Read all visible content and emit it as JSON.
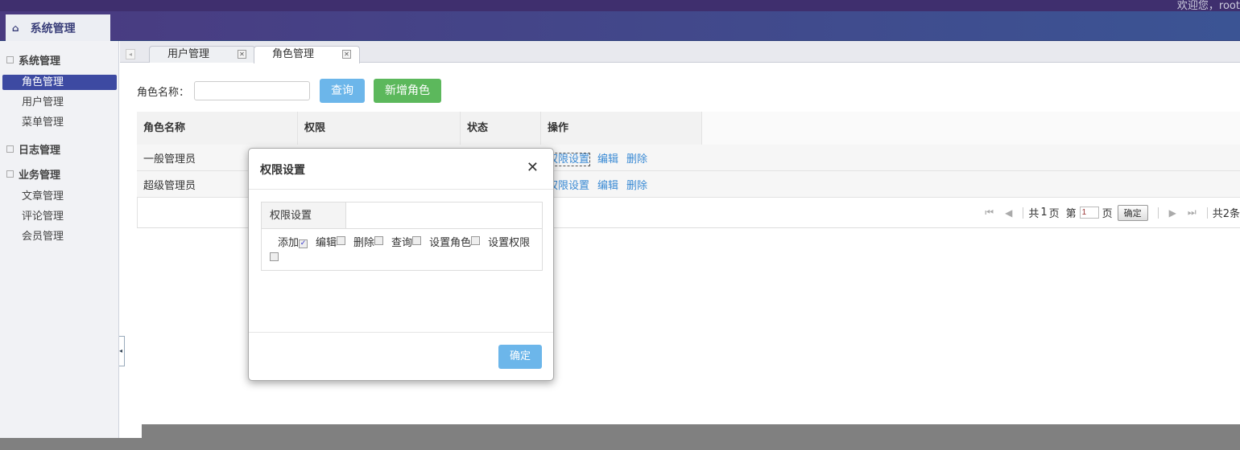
{
  "header": {
    "welcome": "欢迎您，root",
    "app_tab": "系统管理"
  },
  "sidebar": {
    "groups": [
      {
        "label": "系统管理",
        "items": [
          "角色管理",
          "用户管理",
          "菜单管理"
        ]
      },
      {
        "label": "日志管理",
        "items": []
      },
      {
        "label": "业务管理",
        "items": [
          "文章管理",
          "评论管理",
          "会员管理"
        ]
      }
    ],
    "active": "角色管理"
  },
  "tabs": [
    {
      "label": "用户管理"
    },
    {
      "label": "角色管理",
      "active": true
    }
  ],
  "search": {
    "label": "角色名称：",
    "value": "",
    "query_btn": "查询",
    "add_btn": "新增角色"
  },
  "table": {
    "headers": [
      "角色名称",
      "权限",
      "状态",
      "操作"
    ],
    "rows": [
      {
        "name": "一般管理员",
        "actions": [
          "权限设置",
          "编辑",
          "删除"
        ]
      },
      {
        "name": "超级管理员",
        "actions": [
          "权限设置",
          "编辑",
          "删除"
        ]
      }
    ]
  },
  "pager": {
    "total_pages_prefix": "共",
    "total_pages": "1",
    "total_pages_suffix": "页",
    "page_prefix": "第",
    "page": "1",
    "page_suffix": "页",
    "go": "确定",
    "total_records": "共2条"
  },
  "dialog": {
    "title": "权限设置",
    "section": "权限设置",
    "perms": [
      {
        "label": "添加",
        "checked": true
      },
      {
        "label": "编辑",
        "checked": false
      },
      {
        "label": "删除",
        "checked": false
      },
      {
        "label": "查询",
        "checked": false
      },
      {
        "label": "设置角色",
        "checked": false
      },
      {
        "label": "设置权限",
        "checked": false
      }
    ],
    "ok": "确定"
  }
}
